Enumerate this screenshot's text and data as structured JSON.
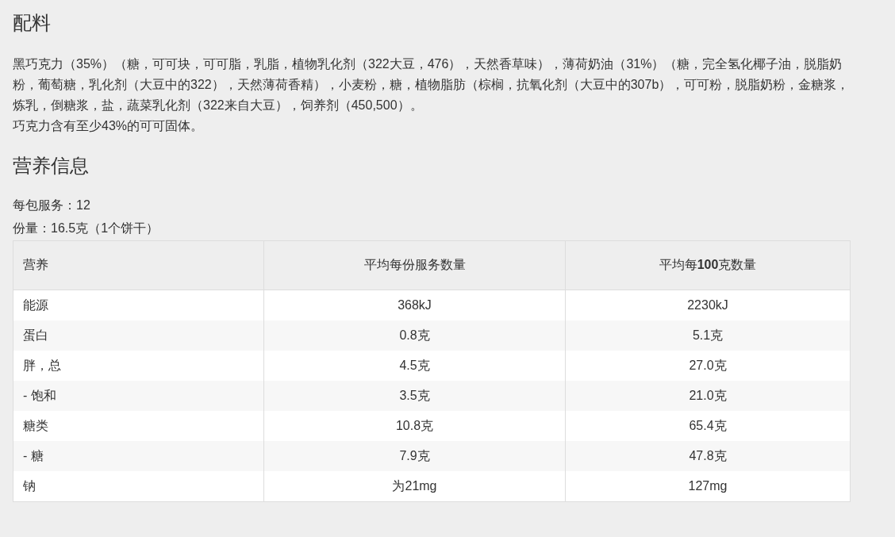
{
  "ingredients": {
    "heading": "配料",
    "paragraphs": [
      "黑巧克力（35%）（糖，可可块，可可脂，乳脂，植物乳化剂（322大豆，476），天然香草味），薄荷奶油（31%）（糖，完全氢化椰子油，脱脂奶粉，葡萄糖，乳化剂（大豆中的322），天然薄荷香精），小麦粉，糖，植物脂肪（棕榈，抗氧化剂（大豆中的307b），可可粉，脱脂奶粉，金糖浆，炼乳，倒糖浆，盐，蔬菜乳化剂（322来自大豆），饲养剂（450,500）。",
      "巧克力含有至少43%的可可固体。"
    ]
  },
  "nutrition": {
    "heading": "营养信息",
    "facts": [
      "每包服务：12",
      "份量：16.5克（1个饼干）"
    ],
    "table": {
      "columns": [
        "营养",
        "平均每份服务数量",
        "平均每**100**克数量"
      ],
      "rows": [
        [
          "能源",
          "368kJ",
          "2230kJ"
        ],
        [
          "蛋白",
          "0.8克",
          "5.1克"
        ],
        [
          "胖，总",
          "4.5克",
          "27.0克"
        ],
        [
          "- 饱和",
          "3.5克",
          "21.0克"
        ],
        [
          "糖类",
          "10.8克",
          "65.4克"
        ],
        [
          "- 糖",
          "7.9克",
          "47.8克"
        ],
        [
          "钠",
          "为21mg",
          "127mg"
        ]
      ]
    }
  }
}
